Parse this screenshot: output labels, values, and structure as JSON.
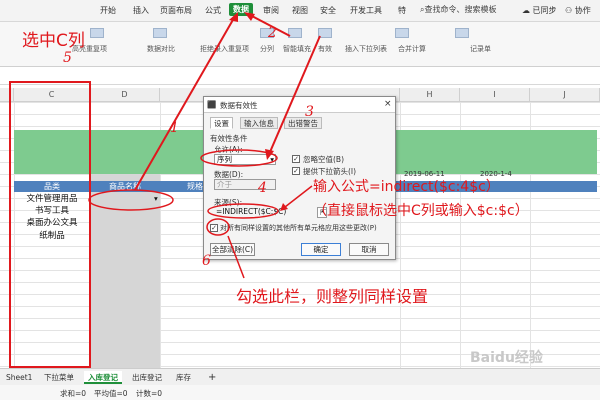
{
  "tabs": [
    "开始",
    "插入",
    "页面布局",
    "公式",
    "数据",
    "审阅",
    "视图",
    "安全",
    "开发工具",
    "特"
  ],
  "search": "查找命令、搜索模板",
  "sync": "已同步",
  "share": "协作",
  "ribbon": {
    "highlight_dup": "高亮重复项",
    "data_compare": "数据对比",
    "reject_dup": "拒绝录入重复项",
    "split": "分列",
    "smart_fill": "智能填充",
    "validity": "有效",
    "insert_dropdown": "插入下拉列表",
    "merge_calc": "合并计算",
    "record": "记录单"
  },
  "columns": [
    "C",
    "D",
    "H",
    "I",
    "J"
  ],
  "table": {
    "header_category": "品类",
    "header_name": "商品名称",
    "header_spec": "规格",
    "items": [
      "文件管理用品",
      "书写工具",
      "桌面办公文具",
      "纸制品"
    ]
  },
  "dates": [
    "2019-06-11",
    "2020-1-4"
  ],
  "dialog": {
    "title": "数据有效性",
    "tabs": [
      "设置",
      "输入信息",
      "出错警告"
    ],
    "section": "有效性条件",
    "allow_label": "允许(A):",
    "allow_value": "序列",
    "ignore_blank": "忽略空值(B)",
    "dropdown": "提供下拉箭头(I)",
    "data_label": "数据(D):",
    "data_value": "介于",
    "source_label": "来源(S):",
    "source_value": "=INDIRECT($C:$C)",
    "apply_all": "对所有同样设置的其他所有单元格应用这些更改(P)",
    "clear_all": "全部清除(C)",
    "ok": "确定",
    "cancel": "取消"
  },
  "annotations": {
    "select_col": "选中C列",
    "formula_hint": "输入公式=indirect($c:4$c）",
    "mouse_hint": "（直接鼠标选中C列或输入$c:$c）",
    "check_hint": "勾选此栏，则整列同样设置",
    "steps": [
      "1",
      "2",
      "3",
      "4",
      "5",
      "6"
    ]
  },
  "sheet_tabs": [
    "Sheet1",
    "下拉菜单",
    "入库登记",
    "出库登记",
    "库存"
  ],
  "add_sheet": "+",
  "status": [
    "求和=0",
    "平均值=0",
    "计数=0"
  ],
  "watermark": "Baidu经验"
}
